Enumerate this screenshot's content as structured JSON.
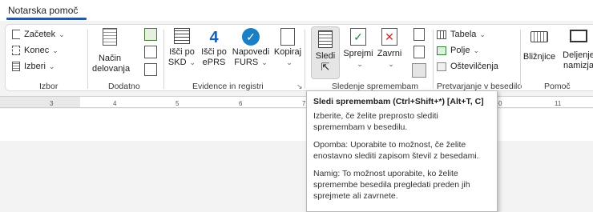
{
  "tabs": {
    "active": "Notarska pomoč"
  },
  "groups": {
    "izbor": {
      "label": "Izbor",
      "items": [
        "Začetek",
        "Konec",
        "Izberi"
      ]
    },
    "dodatno": {
      "label": "Dodatno",
      "nacin": "Način\ndelovanja"
    },
    "evidence": {
      "label": "Evidence in registri",
      "items": [
        "Išči po\nSKD",
        "Išči po\nePRS",
        "Napovedi\nFURS",
        "Kopiraj"
      ]
    },
    "sledenje": {
      "label": "Sledenje spremembam",
      "items": [
        "Sledi",
        "Sprejmi",
        "Zavrni"
      ]
    },
    "pretvarjanje": {
      "label": "Pretvarjanje v besedilo",
      "items": [
        "Tabela",
        "Polje",
        "Oštevilčenja"
      ]
    },
    "pomoc": {
      "label": "Pomoč",
      "items": [
        "Bližnjice",
        "Deljenje\nnamizja"
      ]
    }
  },
  "ruler": {
    "ticks": [
      "3",
      "4",
      "5",
      "6",
      "7",
      "0",
      "11"
    ]
  },
  "tooltip": {
    "title": "Sledi spremembam (Ctrl+Shift+*) [Alt+T, C]",
    "p1": "Izberite, če želite preprosto slediti spremembam v besedilu.",
    "p2": "Opomba: Uporabite to možnost, če želite enostavno slediti zapisom števil z besedami.",
    "p3": "Namig: To možnost uporabite, ko želite spremembe besedila pregledati preden jih sprejmete ali zavrnete."
  }
}
